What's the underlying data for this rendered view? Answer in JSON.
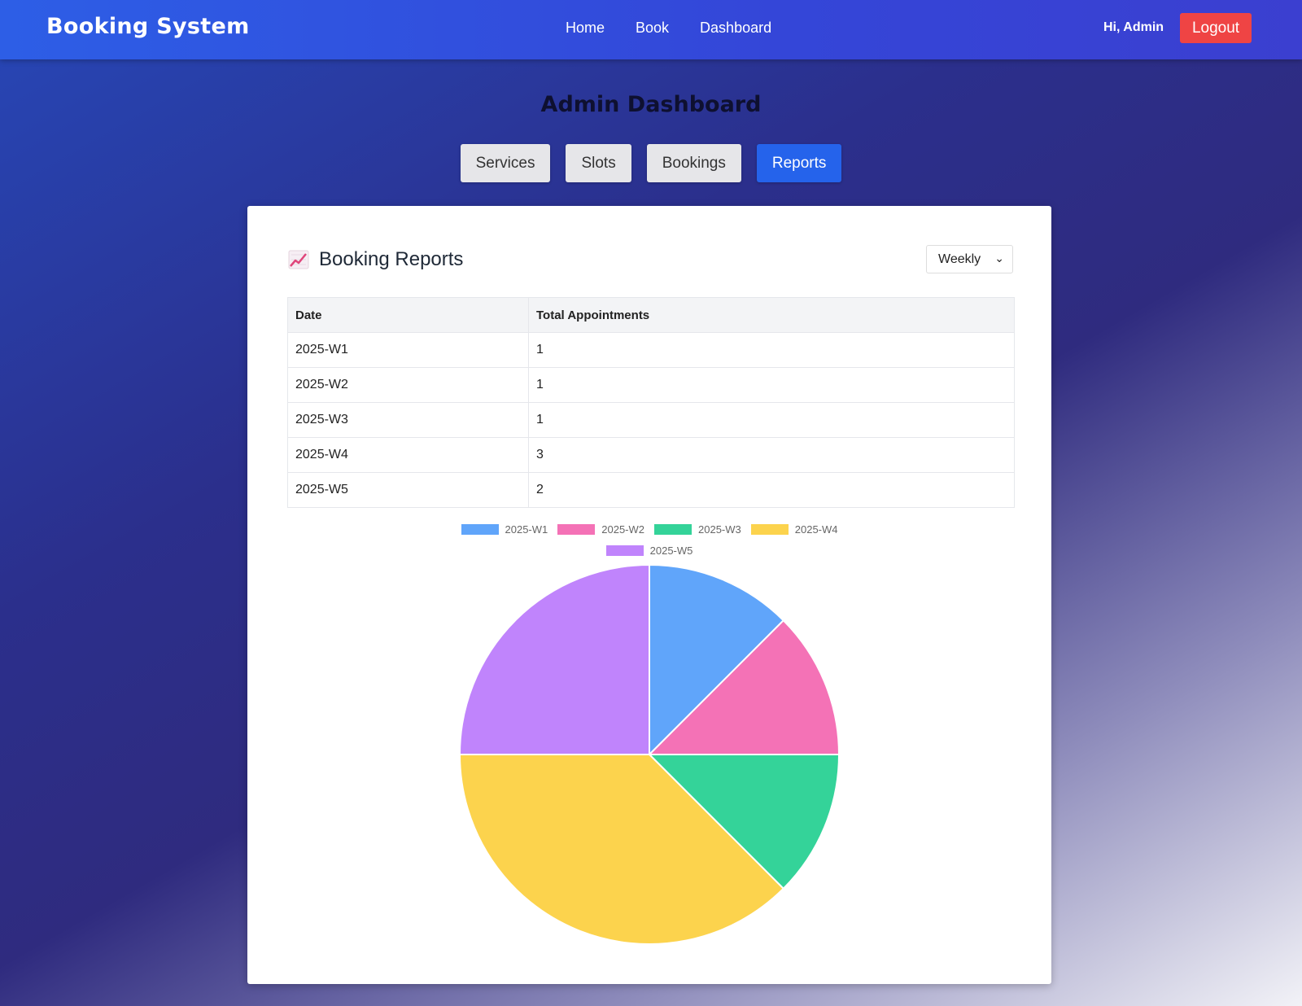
{
  "nav": {
    "brand": "Booking System",
    "links": [
      "Home",
      "Book",
      "Dashboard"
    ],
    "greeting": "Hi, Admin",
    "logout": "Logout"
  },
  "page": {
    "title": "Admin Dashboard",
    "tabs": [
      "Services",
      "Slots",
      "Bookings",
      "Reports"
    ],
    "active_tab": "Reports"
  },
  "report": {
    "title": "Booking Reports",
    "icon": "chart-increasing-icon",
    "period": "Weekly",
    "columns": [
      "Date",
      "Total Appointments"
    ],
    "rows": [
      [
        "2025-W1",
        "1"
      ],
      [
        "2025-W2",
        "1"
      ],
      [
        "2025-W3",
        "1"
      ],
      [
        "2025-W4",
        "3"
      ],
      [
        "2025-W5",
        "2"
      ]
    ]
  },
  "colors": {
    "accent": "#2563eb",
    "logout": "#ef4444"
  },
  "chart_data": {
    "type": "pie",
    "categories": [
      "2025-W1",
      "2025-W2",
      "2025-W3",
      "2025-W4",
      "2025-W5"
    ],
    "values": [
      1,
      1,
      1,
      3,
      2
    ],
    "colors": [
      "#60a5fa",
      "#f472b6",
      "#34d399",
      "#fcd34d",
      "#c084fc"
    ],
    "legend": "top"
  }
}
